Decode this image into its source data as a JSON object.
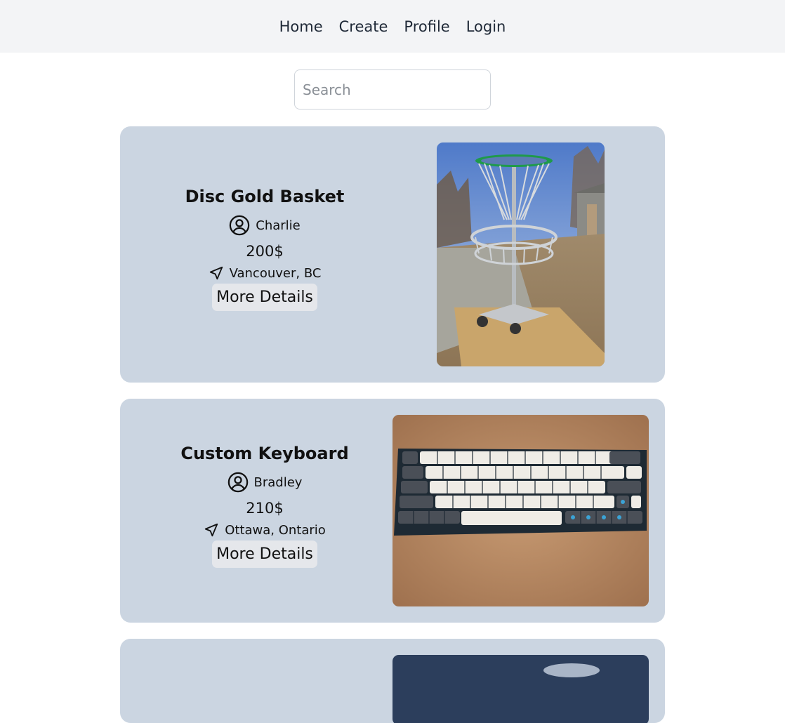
{
  "nav": {
    "items": [
      {
        "label": "Home"
      },
      {
        "label": "Create"
      },
      {
        "label": "Profile"
      },
      {
        "label": "Login"
      }
    ]
  },
  "search": {
    "placeholder": "Search"
  },
  "listings": [
    {
      "title": "Disc Gold Basket",
      "seller": "Charlie",
      "price": "200$",
      "location": "Vancouver, BC",
      "button": "More Details",
      "image": "disc-golf-basket-photo"
    },
    {
      "title": "Custom Keyboard",
      "seller": "Bradley",
      "price": "210$",
      "location": "Ottawa, Ontario",
      "button": "More Details",
      "image": "mechanical-keyboard-photo"
    }
  ],
  "colors": {
    "navbar_bg": "#f3f4f6",
    "card_bg": "#cbd5e1",
    "button_bg": "#e5e7eb"
  }
}
